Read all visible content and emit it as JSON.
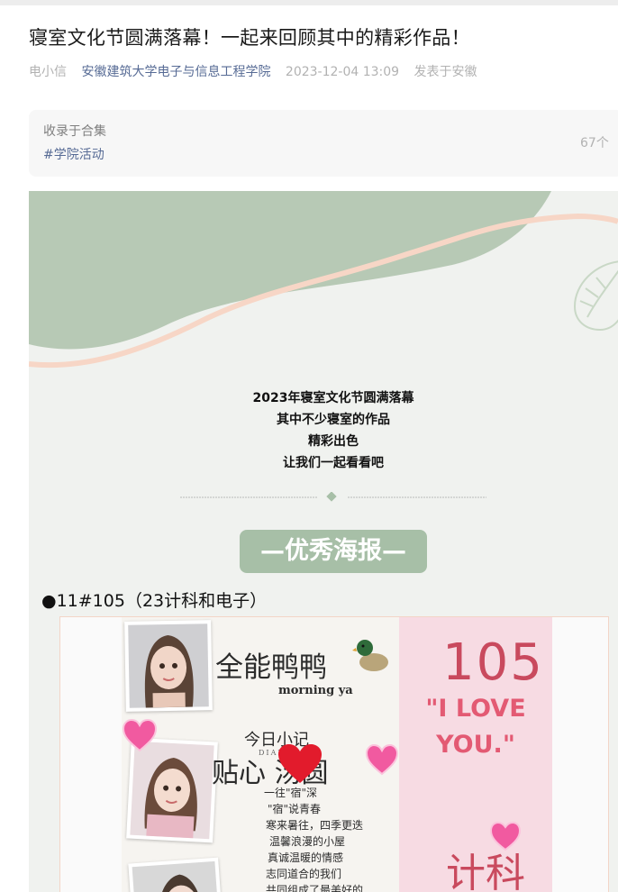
{
  "article": {
    "title": "寝室文化节圆满落幕！一起来回顾其中的精彩作品！",
    "author": "电小信",
    "account": "安徽建筑大学电子与信息工程学院",
    "datetime": "2023-12-04 13:09",
    "location": "发表于安徽"
  },
  "collection": {
    "label": "收录于合集",
    "tag": "#学院活动",
    "count": "67个"
  },
  "intro": {
    "lines": [
      "2023年寝室文化节圆满落幕",
      "其中不少寝室的作品",
      "精彩出色",
      "让我们一起看看吧"
    ]
  },
  "badge": "—优秀海报—",
  "section": "●11#105（23计科和电子）",
  "poster": {
    "title_text": "全能鸭鸭",
    "morning": "morning ya",
    "diary_title": "今日小记",
    "diary_sub": "DIARY",
    "soup": "贴心  汤圆",
    "room_number": "105",
    "love_line1": "\"I LOVE",
    "love_line2": "YOU.\"",
    "bottom_word": "计科",
    "handwritten": [
      "一往\"宿\"深",
      "\"宿\"说青春",
      "寒来暑往，四季更迭",
      "温馨浪漫的小屋",
      "真诚温暖的情感",
      "志同道合的我们",
      "共同组成了最美好的"
    ]
  },
  "colors": {
    "sage": "#b7c9b5",
    "peach": "#f7d6c6",
    "link": "#576b95",
    "badge_bg": "#a7bfa7"
  }
}
